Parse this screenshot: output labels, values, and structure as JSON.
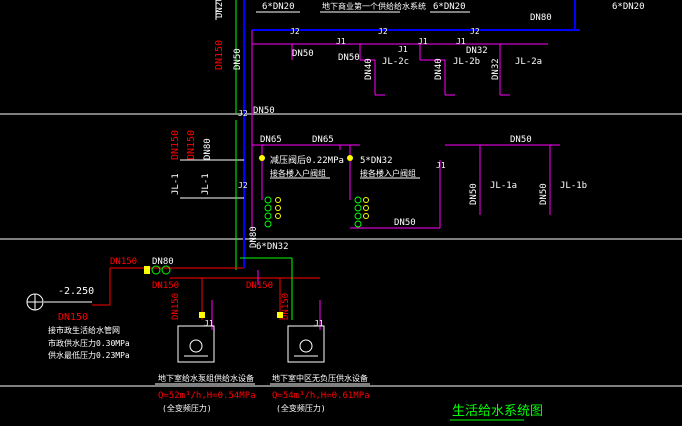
{
  "colors": {
    "background": "#000000",
    "supply_pipe": "#ff00ff",
    "blue_pipe": "#0000ff",
    "red_label": "#ff0000",
    "green_pipe": "#00ff00",
    "white": "#ffffff",
    "yellow": "#ffff00",
    "cyan": "#00ffff"
  },
  "title": "生活给水系统图",
  "labels": {
    "top_riser_dn": "DN20",
    "top_note": "6*DN20",
    "top_desc": "地下商业第一个供给给水系统",
    "top_j2_a": "J2",
    "top_j2_b": "J2",
    "top_right_dn20": "6*DN20",
    "top_j2_right": "J2",
    "top_right_dn80": "DN80",
    "red_riser": "DN150",
    "upper_main_dn": "DN50",
    "upper_j1_a": "J1",
    "upper_dn50_a": "DN50",
    "upper_j1_b": "J1",
    "upper_dn32": "DN32",
    "upper_j1_c": "J1",
    "upper_j1_d": "J1",
    "jl_2c": "JL-2c",
    "jl_2b": "JL-2b",
    "jl_2a": "JL-2a",
    "dn40_a": "DN40",
    "dn40_b": "DN40",
    "dn32_vert": "DN32",
    "j2_mid": "J2",
    "dn50_mid": "DN50",
    "dn65": "DN65",
    "dn65_b": "DN65",
    "dn50_right": "DN50",
    "red_dn150_a": "DN150",
    "red_dn150_b": "DN150",
    "white_dn80": "DN80",
    "jl1_left": "JL-1",
    "jl1_left_b": "JL-1",
    "j1_mid": "J1",
    "j2_mid_b": "J2",
    "press_note": "减压阀后0.22MPa",
    "press_note2": "5*DN32",
    "desc_a": "接各楼入户阀组",
    "desc_b": "接各楼入户阀组",
    "jl_1a": "JL-1a",
    "jl_1b": "JL-1b",
    "dn50_vert_a": "DN50",
    "dn50_vert_b": "DN50",
    "dn50_bottom": "DN50",
    "j1_right": "J1",
    "dn80_lower": "DN80",
    "note_6dn32": "6*DN32",
    "dn150_inlet": "DN150",
    "dn80_valve": "DN80",
    "dn150_valve": "DN150",
    "elev": "-2.250",
    "dn150_inlet_b": "DN150",
    "inlet_desc1": "接市政生活给水管网",
    "inlet_desc2": "市政供水压力0.30MPa",
    "inlet_desc3": "供水最低压力0.23MPa",
    "dn150_pump_a": "DN150",
    "dn150_pump_b": "DN150",
    "dn150_top_pump": "DN150",
    "pump1_title": "地下室给水泵组供给水设备",
    "pump1_spec": "Q=52m³/h,H=0.54MPa",
    "pump1_note": "(全变频压力)",
    "pump2_title": "地下室中区无负压供水设备",
    "pump2_spec": "Q=54m³/h,H=0.61MPa",
    "pump2_note": "(全变频压力)",
    "j1_pump": "J1",
    "j1_pump_b": "J1"
  }
}
